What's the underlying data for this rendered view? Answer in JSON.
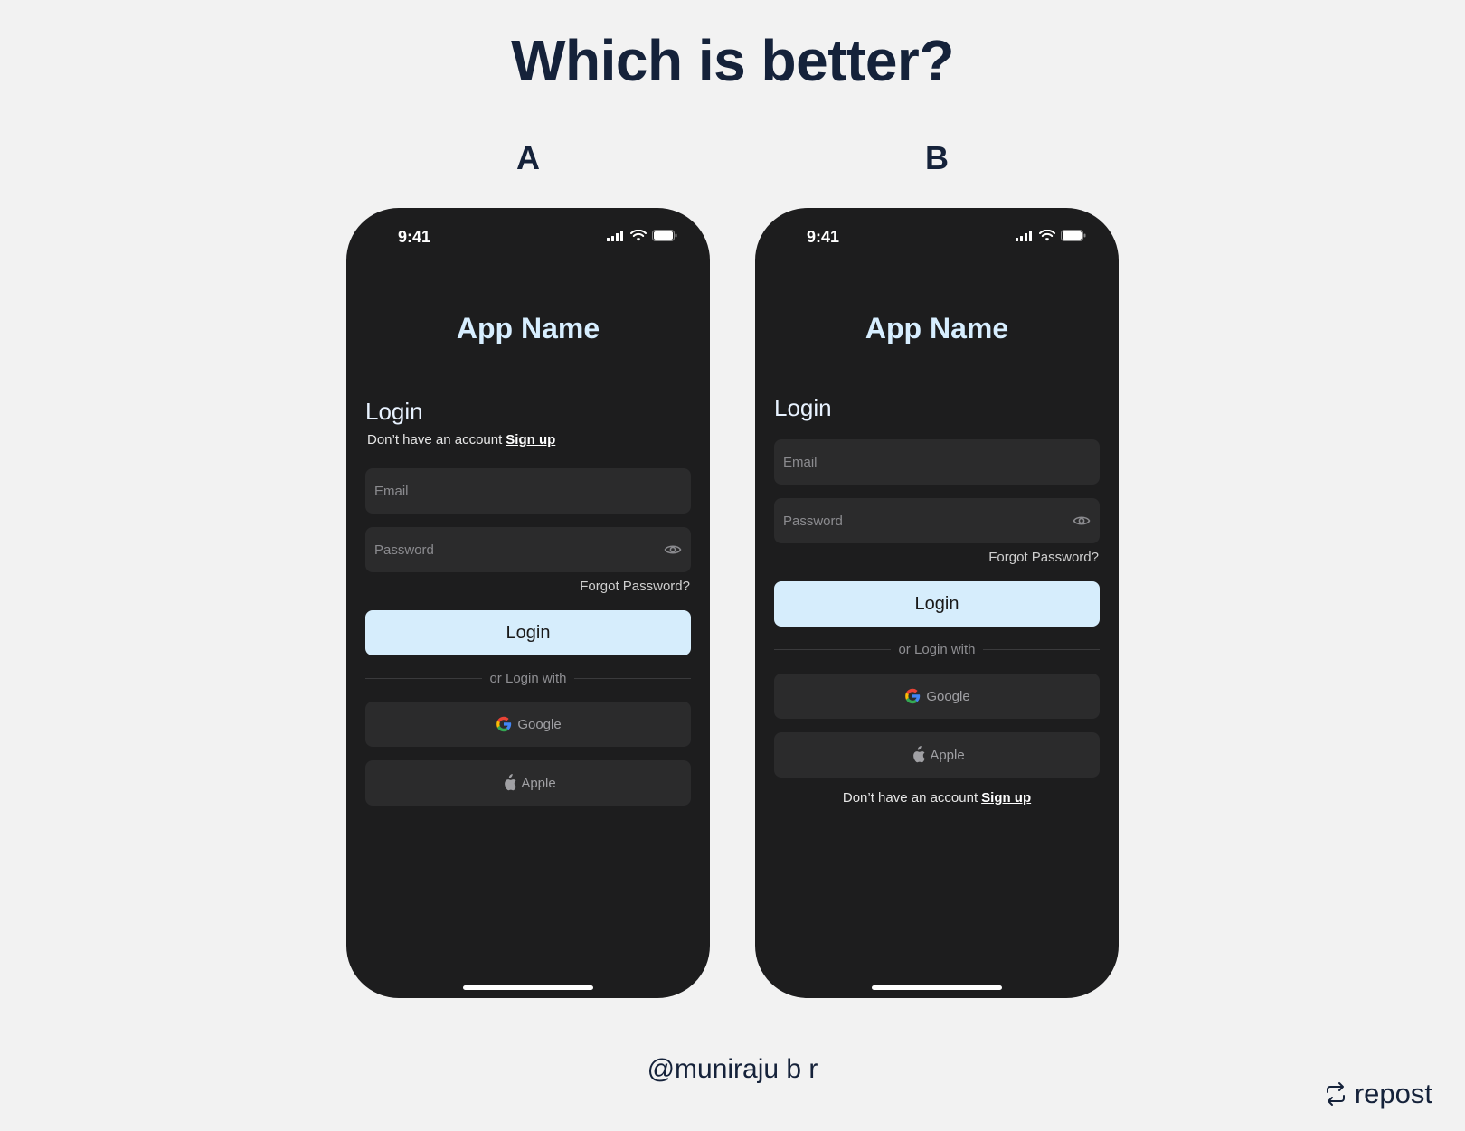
{
  "page": {
    "title": "Which is better?",
    "credit": "@muniraju b r",
    "repost_label": "repost"
  },
  "variants": {
    "a": {
      "label": "A",
      "status": {
        "time": "9:41"
      },
      "app_name": "App Name",
      "login_heading": "Login",
      "signup_prompt": "Don’t have an account",
      "signup_link": "Sign up",
      "email_placeholder": "Email",
      "password_placeholder": "Password",
      "forgot_password": "Forgot Password?",
      "login_button": "Login",
      "divider_text": "or Login with",
      "google_label": "Google",
      "apple_label": "Apple"
    },
    "b": {
      "label": "B",
      "status": {
        "time": "9:41"
      },
      "app_name": "App Name",
      "login_heading": "Login",
      "email_placeholder": "Email",
      "password_placeholder": "Password",
      "forgot_password": "Forgot Password?",
      "login_button": "Login",
      "divider_text": "or Login with",
      "google_label": "Google",
      "apple_label": "Apple",
      "signup_prompt": "Don’t have an account",
      "signup_link": "Sign up"
    }
  },
  "icons": {
    "signal": "cellular-signal-icon",
    "wifi": "wifi-icon",
    "battery": "battery-icon",
    "eye": "eye-icon",
    "google": "google-icon",
    "apple": "apple-icon",
    "repost": "repost-icon"
  },
  "colors": {
    "page_background": "#f2f2f2",
    "phone_background": "#1d1d1e",
    "field_background": "#2b2b2c",
    "accent_button": "#d6edfc",
    "app_name": "#d7eeff",
    "heading_text": "#15223a"
  }
}
